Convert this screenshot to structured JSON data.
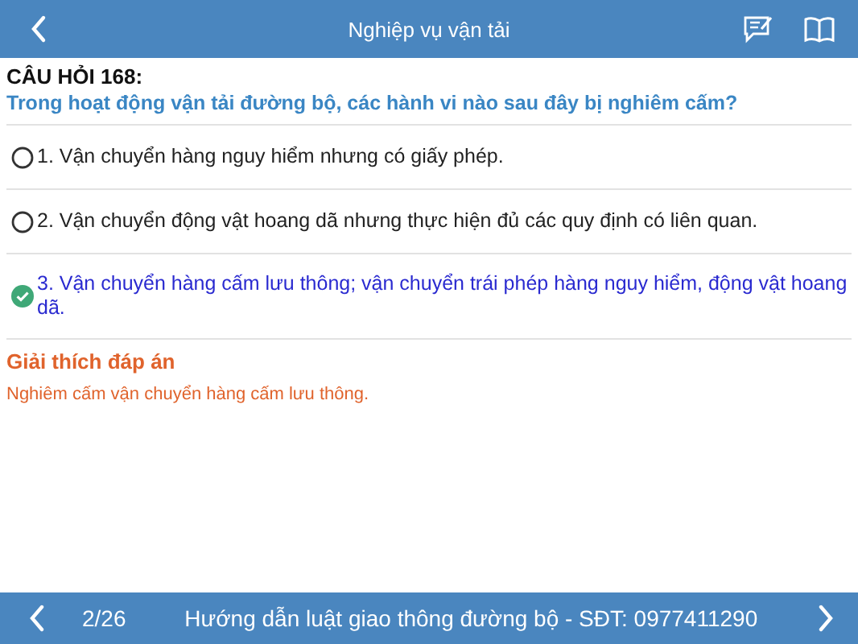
{
  "header": {
    "title": "Nghiệp vụ vận tải"
  },
  "question": {
    "number": "CÂU HỎI 168:",
    "text": "Trong hoạt động vận tải đường bộ, các hành vi nào sau đây bị nghiêm cấm?"
  },
  "answers": [
    {
      "text": "1. Vận chuyển hàng nguy hiểm nhưng có giấy phép.",
      "selected": false
    },
    {
      "text": "2. Vận chuyển động vật hoang dã nhưng thực hiện đủ các quy định có liên quan.",
      "selected": false
    },
    {
      "text": "3. Vận chuyển hàng cấm lưu thông; vận chuyển trái phép hàng nguy hiểm, động vật hoang dã.",
      "selected": true
    }
  ],
  "explanation": {
    "title": "Giải thích đáp án",
    "text": "Nghiêm cấm vận chuyển hàng cấm lưu thông."
  },
  "footer": {
    "page": "2/26",
    "info": "Hướng dẫn luật giao thông đường bộ - SĐT: 0977411290"
  }
}
